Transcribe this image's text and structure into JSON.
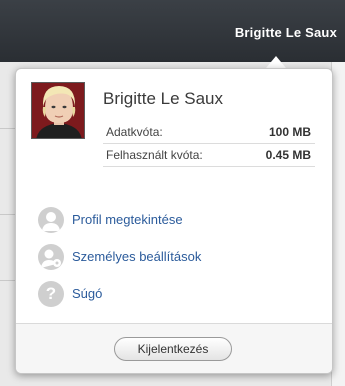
{
  "topbar": {
    "user_name": "Brigitte Le Saux"
  },
  "popup": {
    "user_name": "Brigitte Le Saux",
    "quota": [
      {
        "label": "Adatkvóta:",
        "value": "100 MB"
      },
      {
        "label": "Felhasznált kvóta:",
        "value": "0.45 MB"
      }
    ],
    "menu": [
      {
        "label": "Profil megtekintése",
        "icon": "user-profile-icon"
      },
      {
        "label": "Személyes beállítások",
        "icon": "user-settings-icon"
      },
      {
        "label": "Súgó",
        "icon": "help-icon"
      }
    ],
    "logout_label": "Kijelentkezés"
  },
  "colors": {
    "topbar": "#2f3338",
    "link": "#2b5b9b",
    "icon_gray": "#cfcfcf"
  }
}
